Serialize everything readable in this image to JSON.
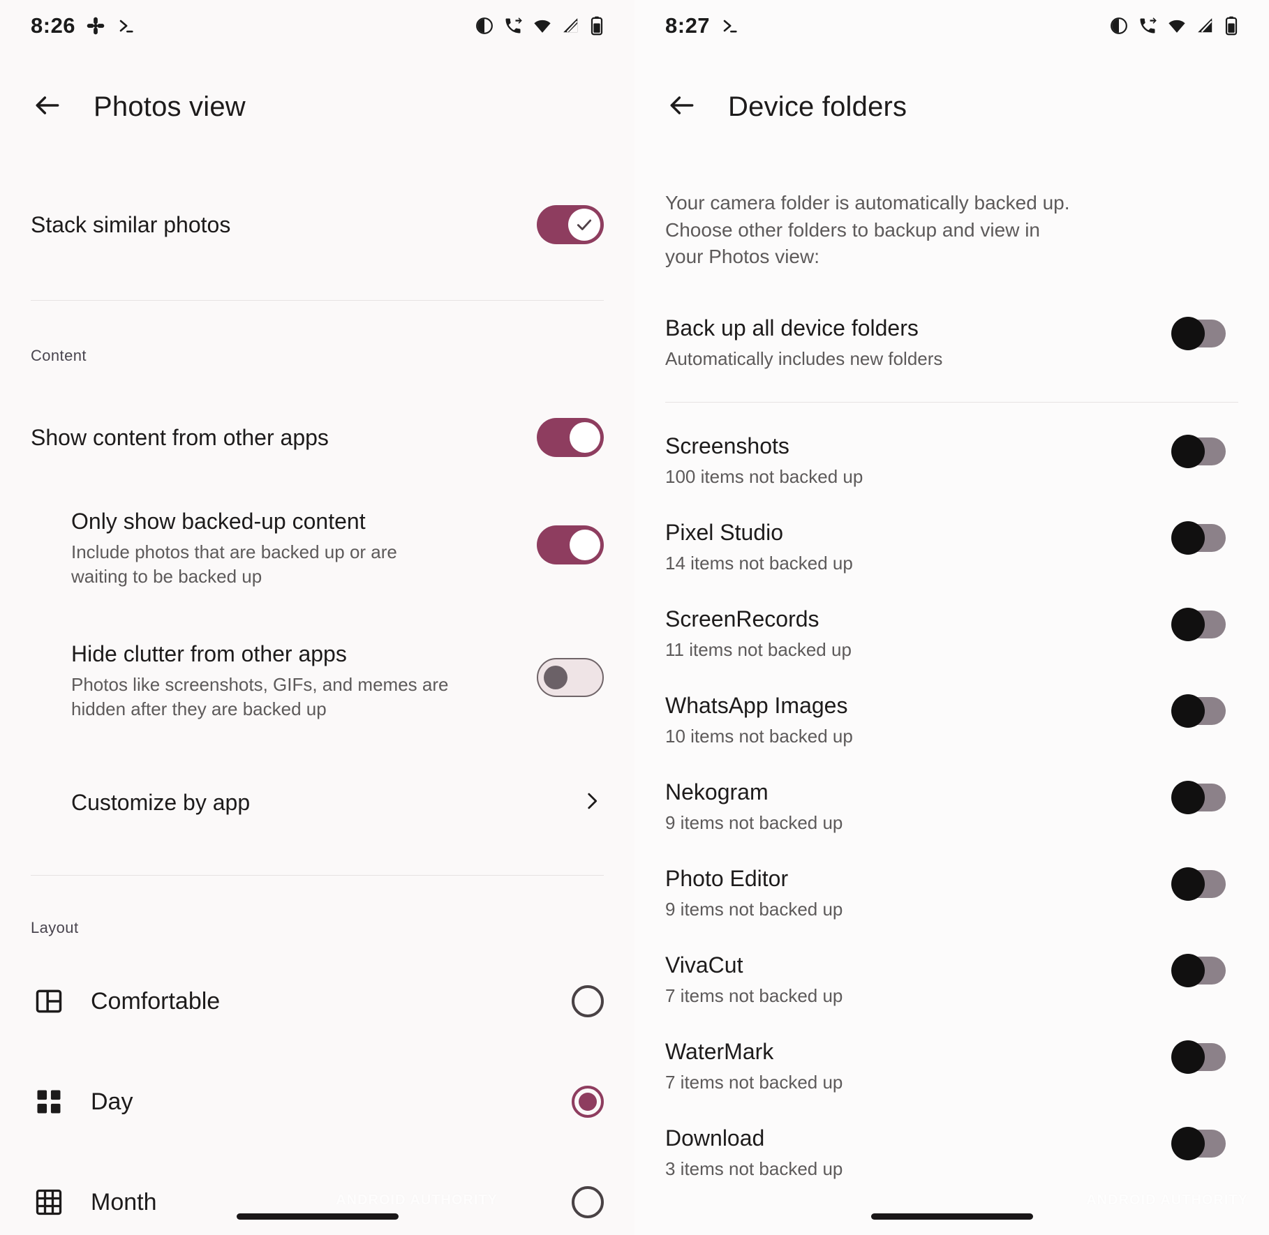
{
  "left_screen": {
    "status_bar": {
      "time": "8:26",
      "icons_left": [
        "cast-icon",
        "terminal-icon"
      ],
      "icons_right": [
        "alarm-icon",
        "call-forward-icon",
        "wifi-icon",
        "signal-icon",
        "battery-icon"
      ]
    },
    "app_bar": {
      "back_icon": "back-arrow-icon",
      "title": "Photos view"
    },
    "stack_row": {
      "title": "Stack similar photos",
      "toggle_state": "on",
      "toggle_icon": "check-icon"
    },
    "content_section": {
      "label": "Content",
      "rows": [
        {
          "title": "Show content from other apps",
          "subtitle": "",
          "toggle_state": "on",
          "indent": false
        },
        {
          "title": "Only show backed-up content",
          "subtitle": "Include photos that are backed up or are waiting to be backed up",
          "toggle_state": "on",
          "indent": true
        },
        {
          "title": "Hide clutter from other apps",
          "subtitle": "Photos like screenshots, GIFs, and memes are hidden after they are backed up",
          "toggle_state": "off",
          "indent": true
        }
      ],
      "customize_row": {
        "title": "Customize by app",
        "chevron_icon": "chevron-right-icon"
      }
    },
    "layout_section": {
      "label": "Layout",
      "options": [
        {
          "label": "Comfortable",
          "icon": "layout-comfortable-icon",
          "selected": false
        },
        {
          "label": "Day",
          "icon": "layout-day-grid-icon",
          "selected": true
        },
        {
          "label": "Month",
          "icon": "layout-month-grid-icon",
          "selected": false
        }
      ]
    },
    "watermark": "ANDROID AUTHORITY"
  },
  "right_screen": {
    "status_bar": {
      "time": "8:27",
      "icons_left": [
        "terminal-icon"
      ],
      "icons_right": [
        "alarm-icon",
        "call-forward-icon",
        "wifi-icon",
        "signal-icon",
        "battery-icon"
      ]
    },
    "app_bar": {
      "back_icon": "back-arrow-icon",
      "title": "Device folders"
    },
    "description": "Your camera folder is automatically backed up. Choose other folders to backup and view in your Photos view:",
    "backup_all": {
      "title": "Back up all device folders",
      "subtitle": "Automatically includes new folders",
      "toggle_state": "off"
    },
    "folders": [
      {
        "name": "Screenshots",
        "status": "100 items not backed up",
        "toggle_state": "off"
      },
      {
        "name": "Pixel Studio",
        "status": "14 items not backed up",
        "toggle_state": "off"
      },
      {
        "name": "ScreenRecords",
        "status": "11 items not backed up",
        "toggle_state": "off"
      },
      {
        "name": "WhatsApp Images",
        "status": "10 items not backed up",
        "toggle_state": "off"
      },
      {
        "name": "Nekogram",
        "status": "9 items not backed up",
        "toggle_state": "off"
      },
      {
        "name": "Photo Editor",
        "status": "9 items not backed up",
        "toggle_state": "off"
      },
      {
        "name": "VivaCut",
        "status": "7 items not backed up",
        "toggle_state": "off"
      },
      {
        "name": "WaterMark",
        "status": "7 items not backed up",
        "toggle_state": "off"
      },
      {
        "name": "Download",
        "status": "3 items not backed up",
        "toggle_state": "off"
      }
    ],
    "watermark": "ANDROID AUTHORITY"
  },
  "colors": {
    "accent": "#8e3d5f",
    "background": "#fbf9f9",
    "text_primary": "#1d1b1b",
    "text_secondary": "#5d5a5a",
    "divider": "#e6e2e2",
    "toggle_off_track": "#8c8189",
    "toggle_off_thumb": "#111010"
  }
}
